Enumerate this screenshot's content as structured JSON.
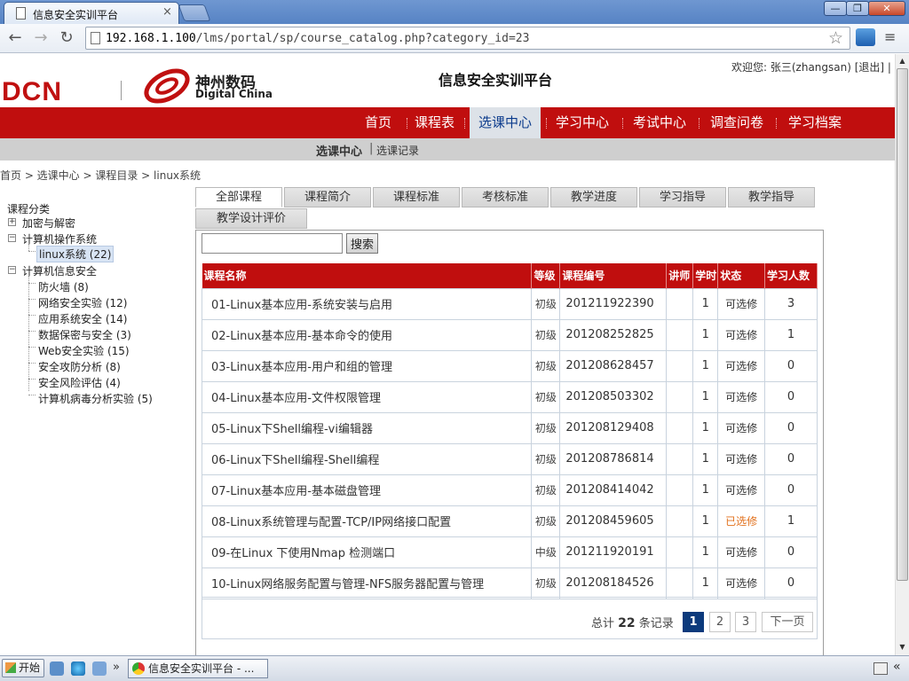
{
  "browser": {
    "tab_title": "信息安全实训平台",
    "tab_close": "×",
    "url_host": "192.168.1.100",
    "url_path": "/lms/portal/sp/course_catalog.php?category_id=23",
    "window_buttons": [
      "—",
      "❐",
      "✕"
    ]
  },
  "header": {
    "logo_brand": "DCN",
    "logo_cn": "神州数码",
    "logo_en": "Digital China",
    "site_title": "信息安全实训平台",
    "welcome": "欢迎您: 张三(zhangsan) [退出] |"
  },
  "nav": {
    "items": [
      "首页",
      "课程表",
      "选课中心",
      "学习中心",
      "考试中心",
      "调查问卷",
      "学习档案"
    ],
    "active": "选课中心"
  },
  "subnav": {
    "current": "选课中心",
    "sep": "|",
    "other": "选课记录"
  },
  "breadcrumb": "首页 > 选课中心 > 课程目录 > linux系统",
  "tree": {
    "title": "课程分类",
    "n1": "加密与解密",
    "n2": "计算机操作系统",
    "n2_child": "linux系统 (22)",
    "n3": "计算机信息安全",
    "n3_children": [
      "防火墙 (8)",
      "网络安全实验 (12)",
      "应用系统安全 (14)",
      "数据保密与安全 (3)",
      "Web安全实验 (15)",
      "安全攻防分析 (8)",
      "安全风险评估 (4)",
      "计算机病毒分析实验 (5)"
    ]
  },
  "tabs": [
    "全部课程",
    "课程简介",
    "课程标准",
    "考核标准",
    "教学进度",
    "学习指导",
    "教学指导",
    "教学设计评价"
  ],
  "search": {
    "button": "搜索",
    "value": ""
  },
  "table": {
    "headers": [
      "课程名称",
      "等级",
      "课程编号",
      "讲师",
      "学时",
      "状态",
      "学习人数"
    ],
    "rows": [
      {
        "name": "01-Linux基本应用-系统安装与启用",
        "level": "初级",
        "code": "201211922390",
        "teacher": "",
        "hours": "1",
        "status": "可选修",
        "count": "3"
      },
      {
        "name": "02-Linux基本应用-基本命令的使用",
        "level": "初级",
        "code": "201208252825",
        "teacher": "",
        "hours": "1",
        "status": "可选修",
        "count": "1"
      },
      {
        "name": "03-Linux基本应用-用户和组的管理",
        "level": "初级",
        "code": "201208628457",
        "teacher": "",
        "hours": "1",
        "status": "可选修",
        "count": "0"
      },
      {
        "name": "04-Linux基本应用-文件权限管理",
        "level": "初级",
        "code": "201208503302",
        "teacher": "",
        "hours": "1",
        "status": "可选修",
        "count": "0"
      },
      {
        "name": "05-Linux下Shell编程-vi编辑器",
        "level": "初级",
        "code": "201208129408",
        "teacher": "",
        "hours": "1",
        "status": "可选修",
        "count": "0"
      },
      {
        "name": "06-Linux下Shell编程-Shell编程",
        "level": "初级",
        "code": "201208786814",
        "teacher": "",
        "hours": "1",
        "status": "可选修",
        "count": "0"
      },
      {
        "name": "07-Linux基本应用-基本磁盘管理",
        "level": "初级",
        "code": "201208414042",
        "teacher": "",
        "hours": "1",
        "status": "可选修",
        "count": "0"
      },
      {
        "name": "08-Linux系统管理与配置-TCP/IP网络接口配置",
        "level": "初级",
        "code": "201208459605",
        "teacher": "",
        "hours": "1",
        "status": "已选修",
        "count": "1"
      },
      {
        "name": "09-在Linux 下使用Nmap 检测端口",
        "level": "中级",
        "code": "201211920191",
        "teacher": "",
        "hours": "1",
        "status": "可选修",
        "count": "0"
      },
      {
        "name": "10-Linux网络服务配置与管理-NFS服务器配置与管理",
        "level": "初级",
        "code": "201208184526",
        "teacher": "",
        "hours": "1",
        "status": "可选修",
        "count": "0"
      }
    ]
  },
  "pager": {
    "prefix": "总计",
    "total": "22",
    "suffix": "条记录",
    "pages": [
      "1",
      "2",
      "3"
    ],
    "next": "下一页"
  },
  "taskbar": {
    "start": "开始",
    "chevron": "»",
    "task": "信息安全实训平台 - ..."
  },
  "colors": {
    "brand_red": "#c00e0e",
    "selected_status": "#e2711d",
    "pager_current": "#0c3a7c"
  }
}
